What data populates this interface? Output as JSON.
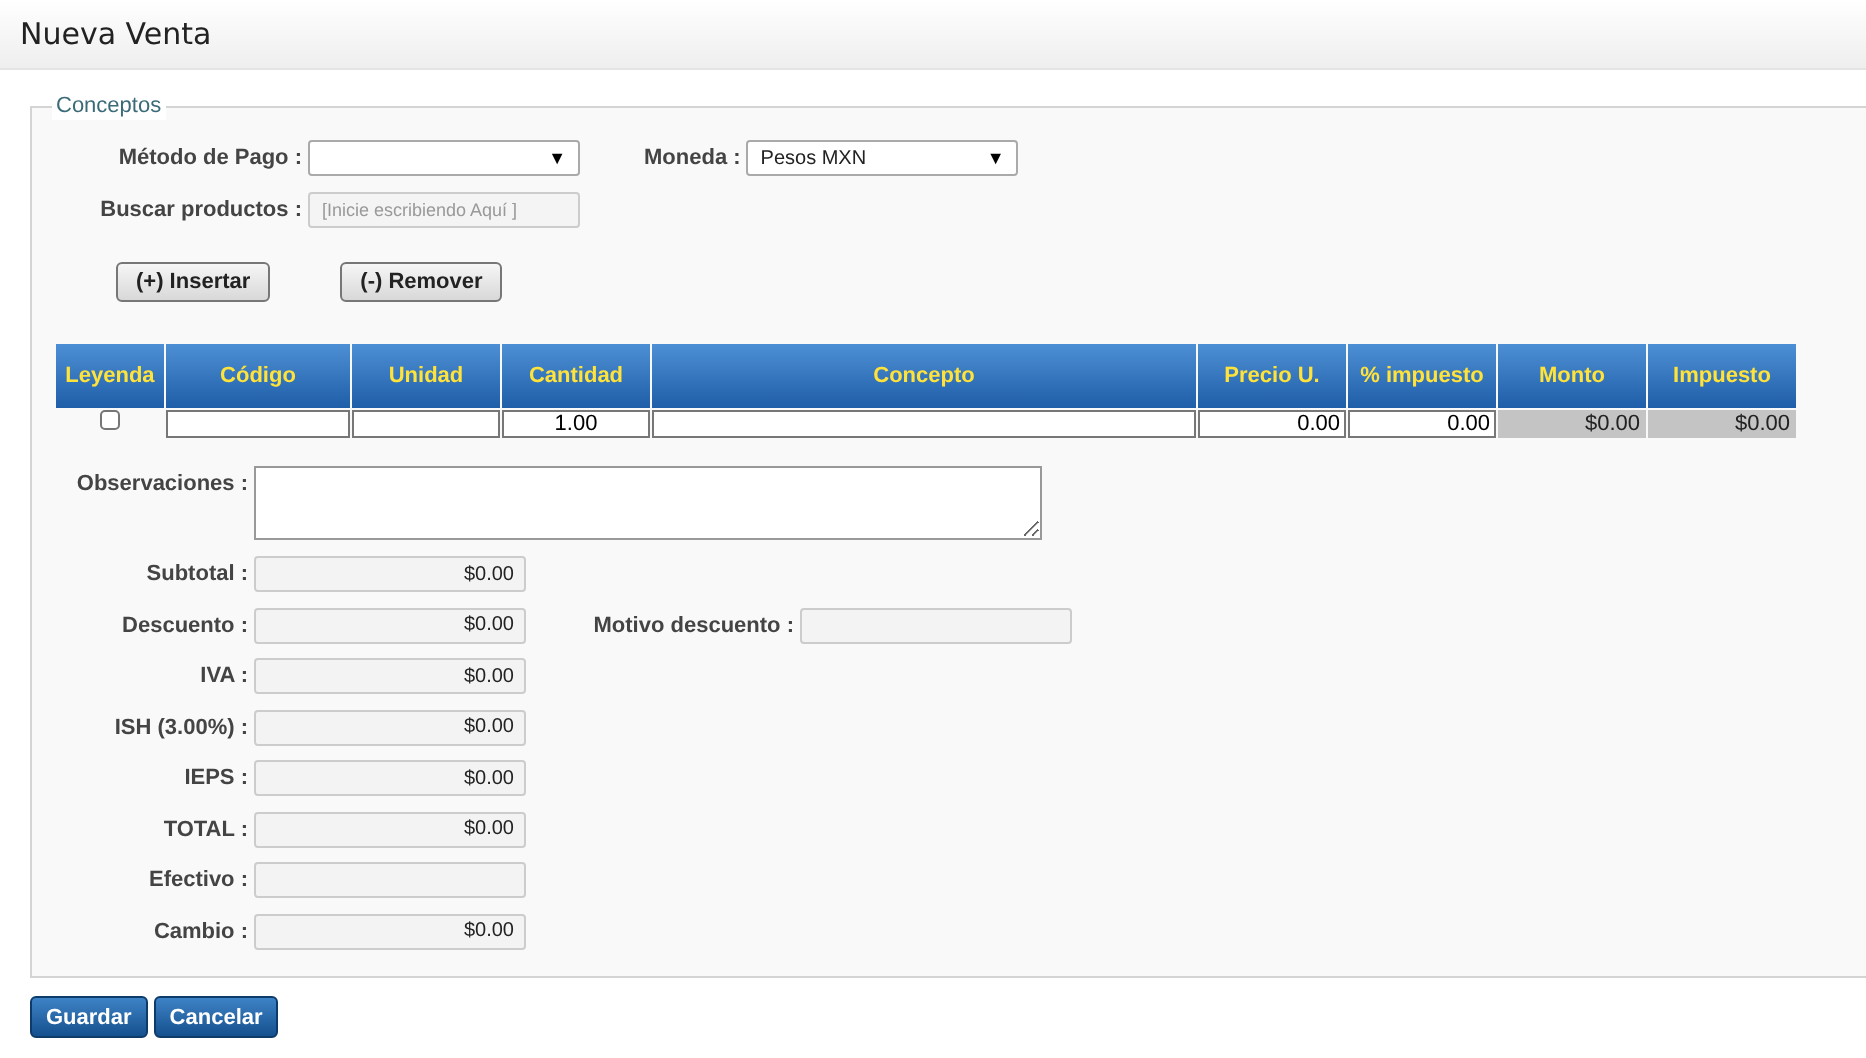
{
  "window": {
    "title": "Nueva Venta"
  },
  "section": {
    "legend": "Conceptos"
  },
  "payment_method": {
    "label": "Método de Pago :",
    "arrow": "▼"
  },
  "currency": {
    "label": "Moneda :",
    "value": "Pesos MXN",
    "arrow": "▼"
  },
  "search": {
    "label": "Buscar productos :",
    "placeholder": "[Inicie escribiendo Aquí ]"
  },
  "actions": [
    "(+) Insertar",
    "(-) Remover"
  ],
  "table": {
    "columns": [
      "Leyenda",
      "Código",
      "Unidad",
      "Cantidad",
      "Concepto",
      "Precio U.",
      "% impuesto",
      "Monto",
      "Impuesto"
    ],
    "rows": [
      {
        "cells": [
          {
            "kind": "checkbox",
            "checked": false
          },
          {
            "kind": "input"
          },
          {
            "kind": "input"
          },
          {
            "value": "1.00",
            "kind": "center"
          },
          {
            "kind": "input"
          },
          {
            "value": "0.00",
            "kind": "input"
          },
          {
            "value": "0.00",
            "kind": "input"
          },
          {
            "value": "$0.00",
            "kind": "readonly"
          },
          {
            "value": "$0.00",
            "kind": "readonly"
          }
        ]
      }
    ]
  },
  "observations": {
    "label": "Observaciones :"
  },
  "totals": [
    {
      "label": "Subtotal :",
      "value": "$0.00"
    },
    {
      "label": "Descuento :",
      "value": "$0.00",
      "extra_label": "Motivo descuento :"
    },
    {
      "label": "IVA :",
      "value": "$0.00"
    },
    {
      "label": "ISH (3.00%) :",
      "value": "$0.00"
    },
    {
      "label": "IEPS :",
      "value": "$0.00"
    },
    {
      "label": "TOTAL :",
      "value": "$0.00"
    },
    {
      "label": "Efectivo :"
    },
    {
      "label": "Cambio :",
      "value": "$0.00"
    }
  ],
  "buttons": [
    "Guardar",
    "Cancelar"
  ]
}
